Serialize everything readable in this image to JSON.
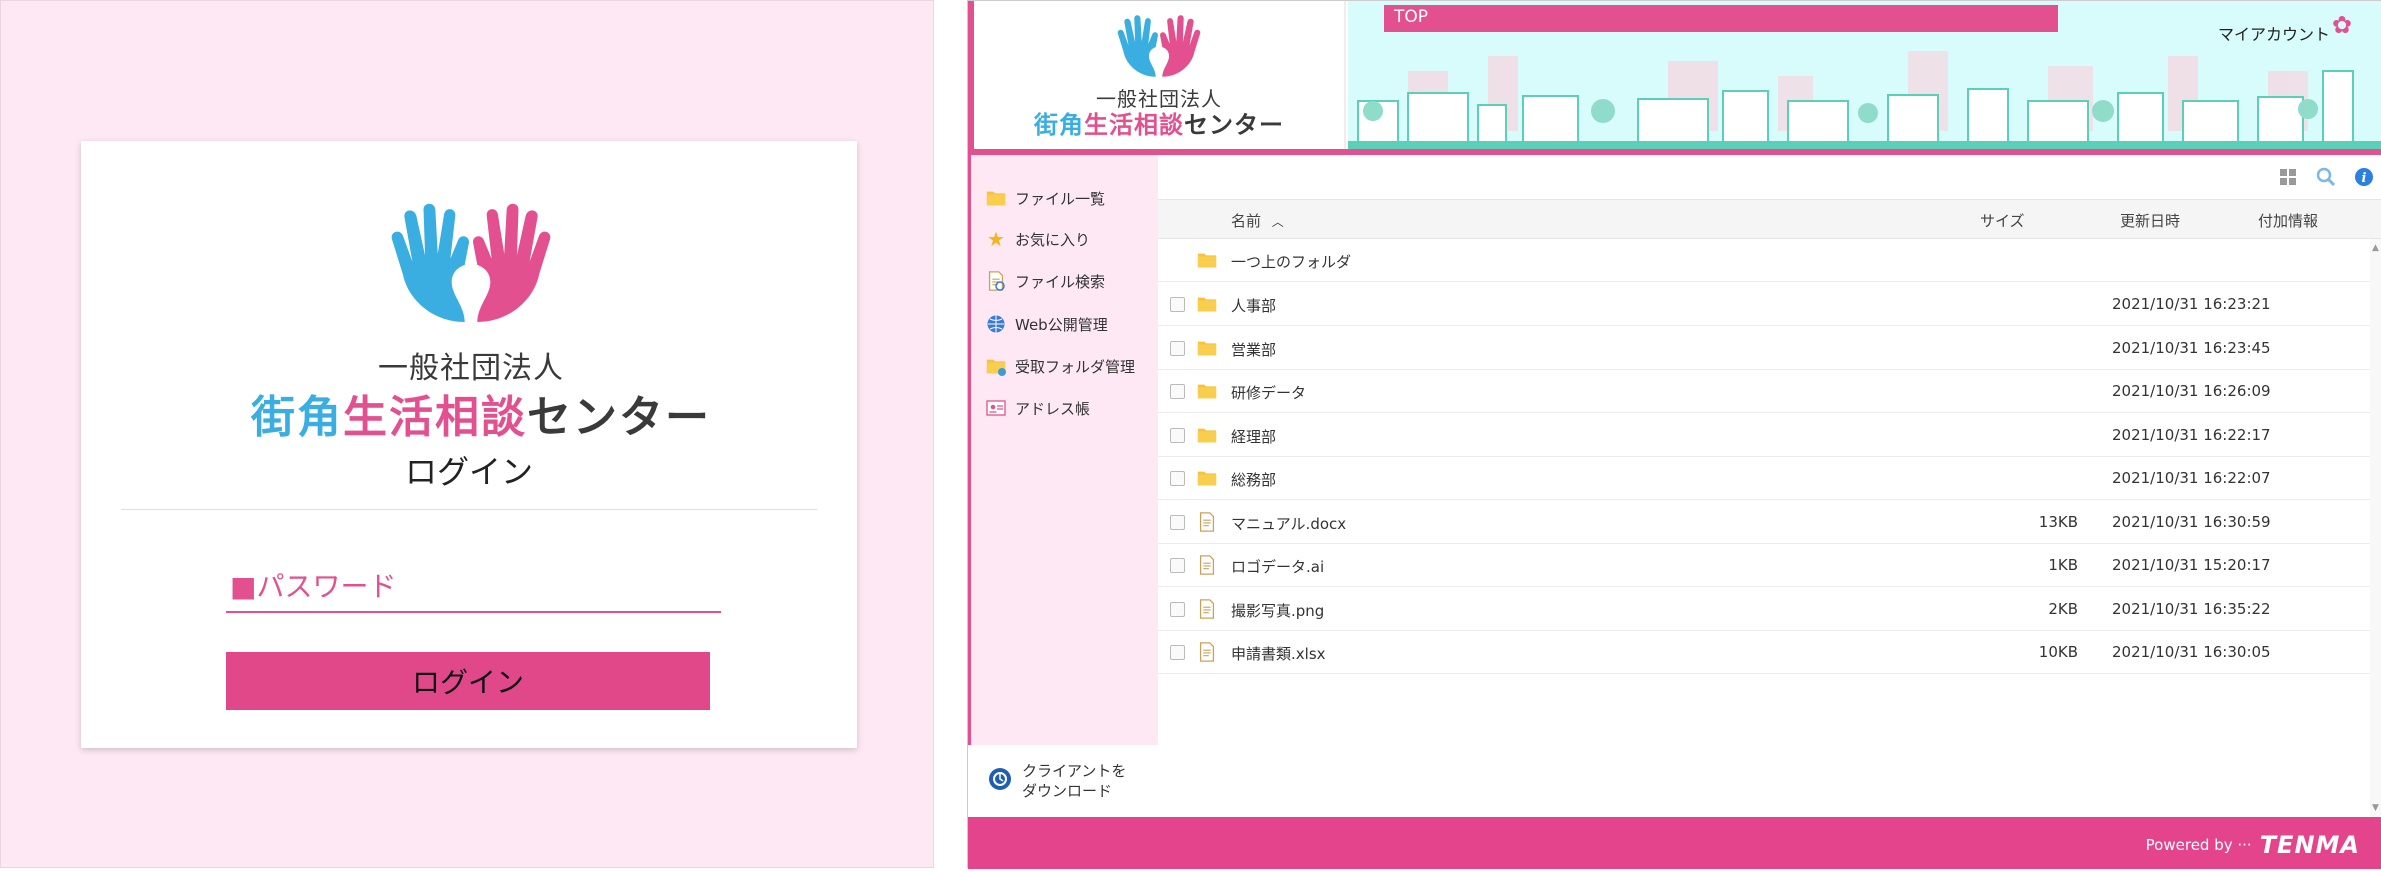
{
  "colors": {
    "brand_pink": "#e2508f",
    "brand_blue": "#3aaee0",
    "login_bg": "#fde8f4",
    "banner_bg": "#d8fbfb"
  },
  "org": {
    "line1": "一般社団法人",
    "line2_part1": "街角",
    "line2_part2": "生活相談",
    "line2_part3": "センター"
  },
  "login": {
    "title": "ログイン",
    "password_placeholder": "■パスワード",
    "button_label": "ログイン"
  },
  "header": {
    "top_label": "TOP",
    "account_label": "マイアカウント"
  },
  "sidebar": {
    "items": [
      {
        "label": "ファイル一覧",
        "icon": "folder-icon"
      },
      {
        "label": "お気に入り",
        "icon": "star-icon"
      },
      {
        "label": "ファイル検索",
        "icon": "file-search-icon"
      },
      {
        "label": "Web公開管理",
        "icon": "globe-icon"
      },
      {
        "label": "受取フォルダ管理",
        "icon": "inbox-folder-icon"
      },
      {
        "label": "アドレス帳",
        "icon": "address-book-icon"
      }
    ],
    "download_line1": "クライアントを",
    "download_line2": "ダウンロード"
  },
  "toolbar": {
    "icons": [
      "grid-view-icon",
      "search-icon",
      "info-icon"
    ]
  },
  "table": {
    "col_name": "名前",
    "col_size": "サイズ",
    "col_date": "更新日時",
    "col_info": "付加情報",
    "parent_folder": "一つ上のフォルダ",
    "rows": [
      {
        "name": "人事部",
        "type": "folder",
        "size": "",
        "date": "2021/10/31 16:23:21"
      },
      {
        "name": "営業部",
        "type": "folder",
        "size": "",
        "date": "2021/10/31 16:23:45"
      },
      {
        "name": "研修データ",
        "type": "folder",
        "size": "",
        "date": "2021/10/31 16:26:09"
      },
      {
        "name": "経理部",
        "type": "folder",
        "size": "",
        "date": "2021/10/31 16:22:17"
      },
      {
        "name": "総務部",
        "type": "folder",
        "size": "",
        "date": "2021/10/31 16:22:07"
      },
      {
        "name": "マニュアル.docx",
        "type": "file",
        "size": "13KB",
        "date": "2021/10/31 16:30:59"
      },
      {
        "name": "ロゴデータ.ai",
        "type": "file",
        "size": "1KB",
        "date": "2021/10/31 15:20:17"
      },
      {
        "name": "撮影写真.png",
        "type": "file",
        "size": "2KB",
        "date": "2021/10/31 16:35:22"
      },
      {
        "name": "申請書類.xlsx",
        "type": "file",
        "size": "10KB",
        "date": "2021/10/31 16:30:05"
      }
    ]
  },
  "footer": {
    "powered_by": "Powered by ···",
    "brand": "TENMA"
  }
}
